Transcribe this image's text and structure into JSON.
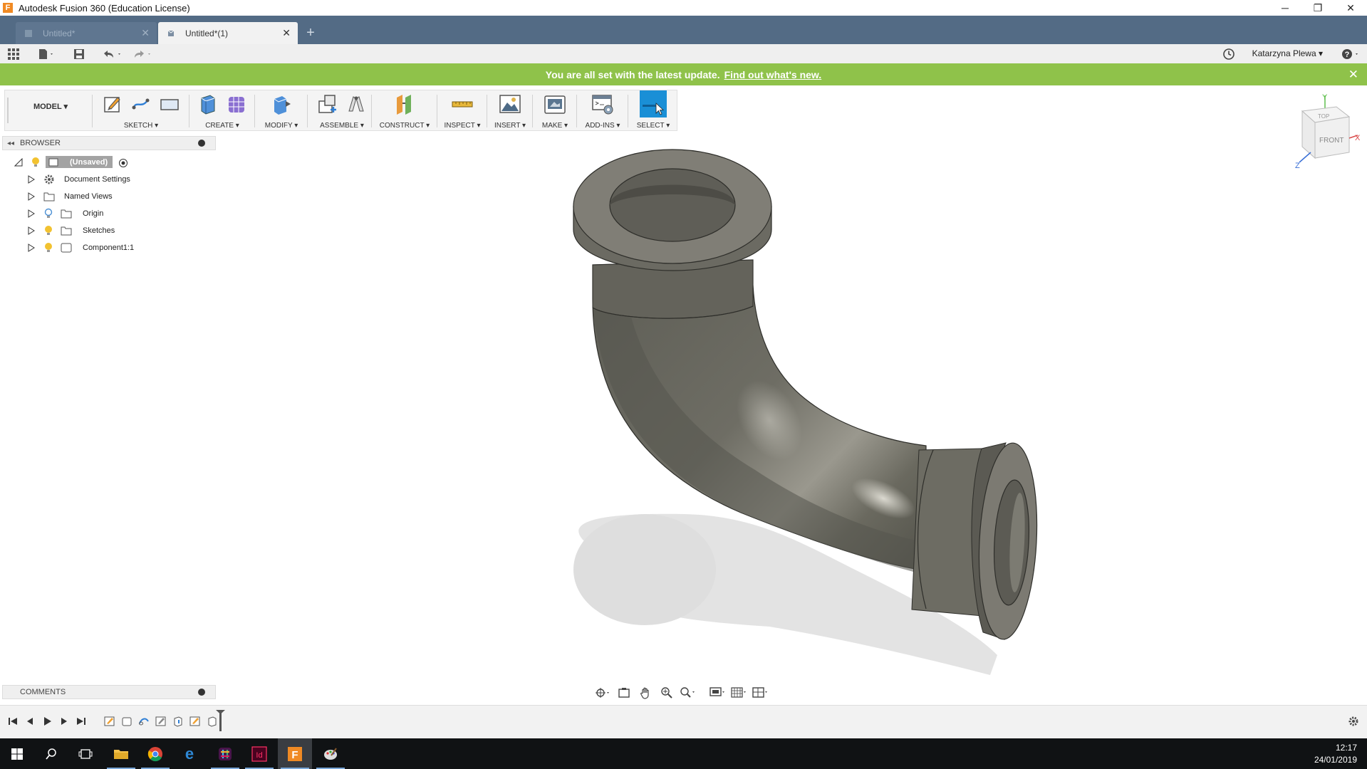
{
  "window": {
    "title": "Autodesk Fusion 360 (Education License)",
    "controls": {
      "minimize": "─",
      "restore": "❐",
      "close": "✕"
    }
  },
  "tabs": [
    {
      "label": "Untitled*",
      "active": false,
      "close": "✕"
    },
    {
      "label": "Untitled*(1)",
      "active": true,
      "close": "✕"
    }
  ],
  "new_tab": "+",
  "quick_access": {
    "user": "Katarzyna Plewa ▾"
  },
  "banner": {
    "text": "You are all set with the latest update.",
    "link": "Find out what's new.",
    "close": "✕",
    "color": "#8fc24a"
  },
  "ribbon": {
    "workspace": "MODEL ▾",
    "groups": [
      {
        "label": "SKETCH ▾"
      },
      {
        "label": "CREATE ▾"
      },
      {
        "label": "MODIFY ▾"
      },
      {
        "label": "ASSEMBLE ▾"
      },
      {
        "label": "CONSTRUCT ▾"
      },
      {
        "label": "INSPECT ▾"
      },
      {
        "label": "INSERT ▾"
      },
      {
        "label": "MAKE ▾"
      },
      {
        "label": "ADD-INS ▾"
      },
      {
        "label": "SELECT ▾"
      }
    ],
    "accent": "#1a8fd6"
  },
  "browser": {
    "title": "BROWSER",
    "collapse": "◂◂",
    "items": [
      {
        "label": "(Unsaved)"
      },
      {
        "label": "Document Settings"
      },
      {
        "label": "Named Views"
      },
      {
        "label": "Origin"
      },
      {
        "label": "Sketches"
      },
      {
        "label": "Component1:1"
      }
    ]
  },
  "viewcube": {
    "top": "TOP",
    "front": "FRONT",
    "x": "X",
    "y": "Y",
    "z": "Z"
  },
  "comments": {
    "title": "COMMENTS"
  },
  "taskbar": {
    "time": "12:17",
    "date": "24/01/2019"
  }
}
